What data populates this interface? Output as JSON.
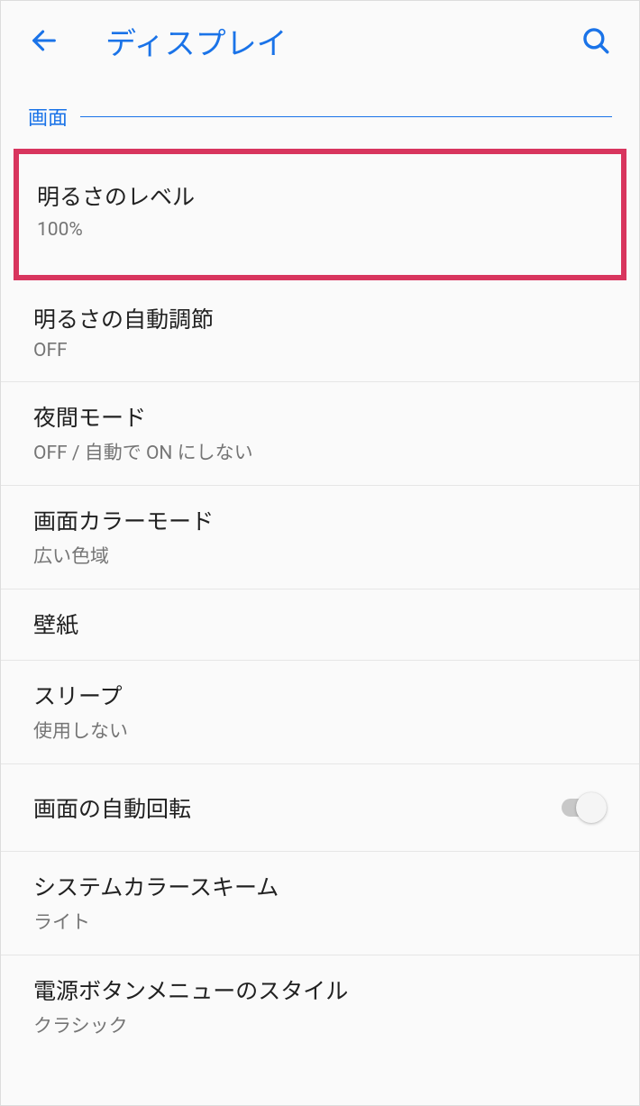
{
  "header": {
    "title": "ディスプレイ"
  },
  "section": {
    "label": "画面"
  },
  "items": {
    "brightness": {
      "title": "明るさのレベル",
      "value": "100%"
    },
    "autoBrightness": {
      "title": "明るさの自動調節",
      "value": "OFF"
    },
    "nightMode": {
      "title": "夜間モード",
      "value": "OFF / 自動で ON にしない"
    },
    "colorMode": {
      "title": "画面カラーモード",
      "value": "広い色域"
    },
    "wallpaper": {
      "title": "壁紙"
    },
    "sleep": {
      "title": "スリープ",
      "value": "使用しない"
    },
    "autoRotate": {
      "title": "画面の自動回転",
      "on": false
    },
    "colorScheme": {
      "title": "システムカラースキーム",
      "value": "ライト"
    },
    "powerButtonMenu": {
      "title": "電源ボタンメニューのスタイル",
      "value": "クラシック"
    }
  }
}
